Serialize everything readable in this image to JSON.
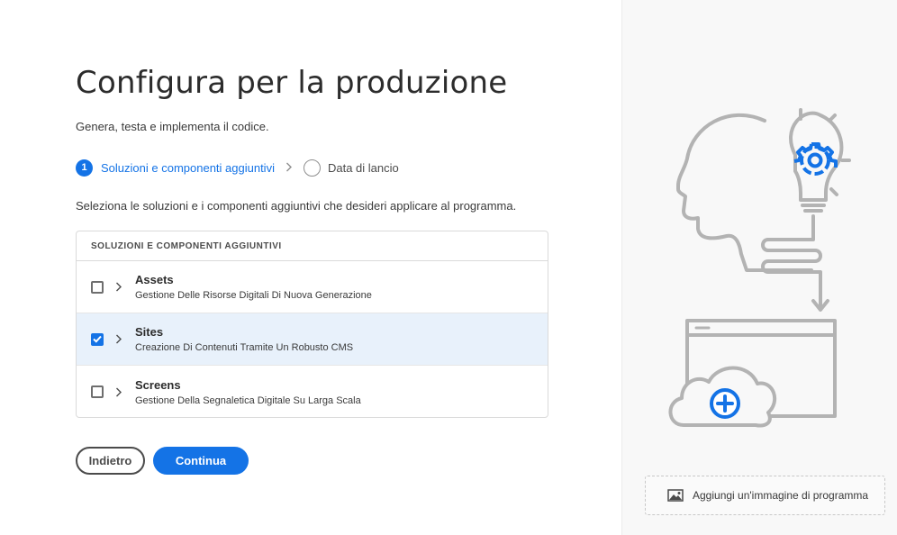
{
  "page": {
    "title": "Configura per la produzione",
    "subtitle": "Genera, testa e implementa il codice."
  },
  "steps": {
    "current_number": "1",
    "current_label": "Soluzioni e componenti aggiuntivi",
    "next_label": "Data di lancio"
  },
  "instruction": "Seleziona le soluzioni e i componenti aggiuntivi che desideri applicare al programma.",
  "solutions": {
    "header": "SOLUZIONI E COMPONENTI AGGIUNTIVI",
    "items": [
      {
        "title": "Assets",
        "description": "Gestione Delle Risorse Digitali Di Nuova Generazione",
        "checked": false
      },
      {
        "title": "Sites",
        "description": "Creazione Di Contenuti Tramite Un Robusto CMS",
        "checked": true
      },
      {
        "title": "Screens",
        "description": "Gestione Della Segnaletica Digitale Su Larga Scala",
        "checked": false
      }
    ]
  },
  "buttons": {
    "back": "Indietro",
    "continue": "Continua"
  },
  "aside": {
    "add_image_label": "Aggiungi un'immagine di programma"
  },
  "colors": {
    "accent": "#1473e6",
    "selected_row": "#e8f1fb",
    "illustration_stroke": "#b3b3b3"
  },
  "icons": {
    "step_separator": "chevron-right-icon",
    "row_expand": "chevron-right-icon",
    "illustration_badge": "gear-icon",
    "cloud_badge": "plus-circle-icon",
    "add_image": "image-icon"
  }
}
